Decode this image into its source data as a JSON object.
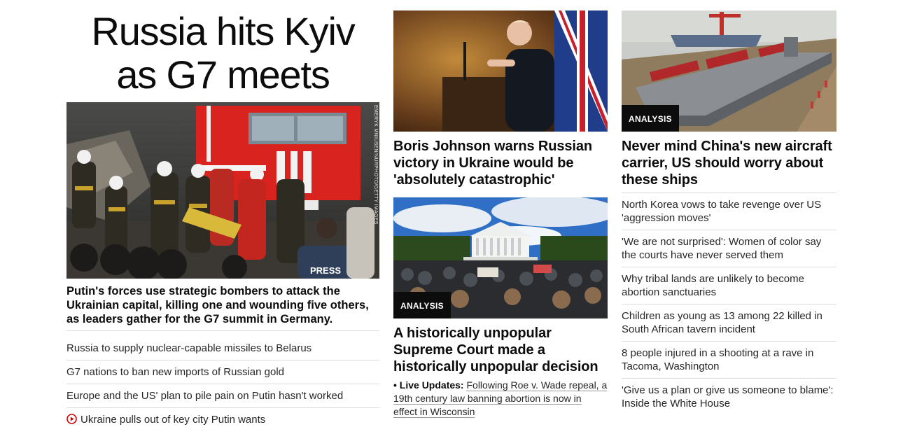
{
  "main_story": {
    "headline": "Russia hits Kyiv as G7 meets",
    "photo_credit": "EMERYK MNIUSEN/NURPHOTO/GETTY IMAGES",
    "summary": "Putin's forces use strategic bombers to attack the Ukrainian capital, killing one and wounding five others, as leaders gather for the G7 summit in Germany.",
    "related": [
      {
        "text": "Russia to supply nuclear-capable missiles to Belarus"
      },
      {
        "text": "G7 nations to ban new imports of Russian gold"
      },
      {
        "text": "Europe and the US' plan to pile pain on Putin hasn't worked"
      },
      {
        "text": "Ukraine pulls out of key city Putin wants",
        "icon": "play-video-icon"
      }
    ]
  },
  "middle": {
    "card1": {
      "title": "Boris Johnson warns Russian victory in Ukraine would be 'absolutely catastrophic'"
    },
    "card2": {
      "badge": "ANALYSIS",
      "title": "A historically unpopular Supreme Court made a historically unpopular decision",
      "live_bullet": "• Live Updates:",
      "live_text": "Following Roe v. Wade repeal, a 19th century law banning abortion is now in effect in Wisconsin"
    }
  },
  "right": {
    "card": {
      "badge": "ANALYSIS",
      "title": "Never mind China's new aircraft carrier, US should worry about these ships"
    },
    "links": [
      {
        "text": "North Korea vows to take revenge over US 'aggression moves'"
      },
      {
        "text": "'We are not surprised': Women of color say the courts have never served them"
      },
      {
        "text": "Why tribal lands are unlikely to become abortion sanctuaries"
      },
      {
        "text": "Children as young as 13 among 22 killed in South African tavern incident"
      },
      {
        "text": "8 people injured in a shooting at a rave in Tacoma, Washington"
      },
      {
        "text": "'Give us a plan or give us someone to blame': Inside the White House"
      }
    ]
  },
  "colors": {
    "accent_red": "#cc0000",
    "badge_bg": "#0c0c0c",
    "divider": "#dcdcdc"
  }
}
